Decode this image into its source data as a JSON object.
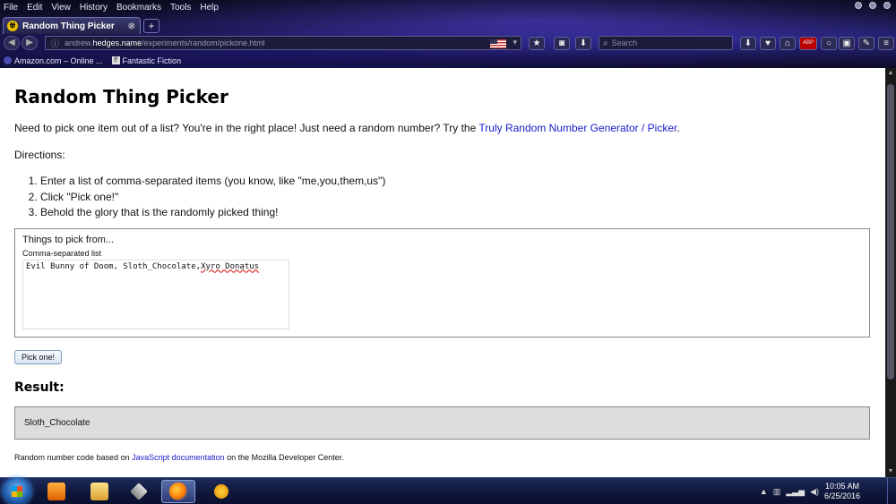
{
  "browser": {
    "menu": [
      "File",
      "Edit",
      "View",
      "History",
      "Bookmarks",
      "Tools",
      "Help"
    ],
    "tab_title": "Random Thing Picker",
    "url_prefix": "andrew.",
    "url_domain": "hedges.name",
    "url_path": "/experiments/random/pickone.html",
    "search_placeholder": "Search",
    "abp_badge": "ABP",
    "bookmarks": [
      "Amazon.com – Online ...",
      "Fantastic Fiction"
    ]
  },
  "page": {
    "title": "Random Thing Picker",
    "intro_text": "Need to pick one item out of a list? You're in the right place! Just need a random number? Try the ",
    "intro_link": "Truly Random Number Generator / Picker",
    "intro_end": ".",
    "directions_label": "Directions:",
    "steps": [
      "Enter a list of comma-separated items (you know, like \"me,you,them,us\")",
      "Click \"Pick one!\"",
      "Behold the glory that is the randomly picked thing!"
    ],
    "fieldset_legend": "Things to pick from...",
    "field_label": "Comma-separated list",
    "textarea_value_plain": "Evil Bunny of Doom, Sloth_Chocolate,",
    "textarea_value_misspelled": "Xyro Donatus",
    "pick_button": "Pick one!",
    "result_heading": "Result:",
    "result_value": "Sloth_Chocolate",
    "footer_text": "Random number code based on ",
    "footer_link": "JavaScript documentation",
    "footer_end": " on the Mozilla Developer Center."
  },
  "taskbar": {
    "time": "10:05 AM",
    "date": "6/25/2016"
  }
}
